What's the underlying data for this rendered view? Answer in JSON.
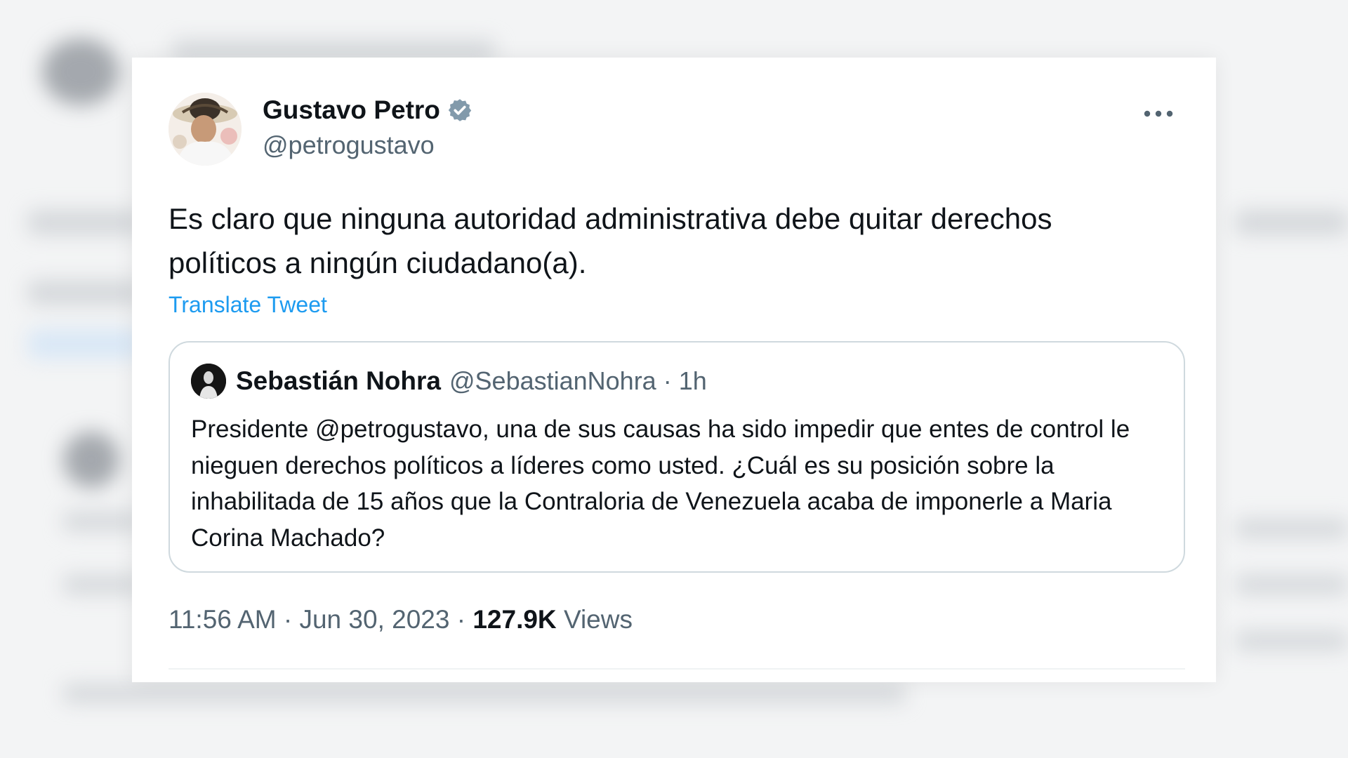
{
  "author": {
    "name": "Gustavo Petro",
    "handle": "@petrogustavo",
    "verified_icon": "verified-badge-icon"
  },
  "tweet": {
    "text": "Es claro que ninguna autoridad administrativa debe quitar derechos políticos a ningún ciudadano(a).",
    "translate_label": "Translate Tweet"
  },
  "quote": {
    "name": "Sebastián Nohra",
    "handle": "@SebastianNohra",
    "separator": "·",
    "time": "1h",
    "text": "Presidente @petrogustavo, una de sus causas ha sido impedir que entes de control le nieguen derechos políticos a líderes como usted. ¿Cuál es su posición sobre la inhabilitada de 15 años que la Contraloria de Venezuela acaba de imponerle a Maria Corina Machado?"
  },
  "meta": {
    "time": "11:56 AM",
    "separator": "·",
    "date": "Jun 30, 2023",
    "views_count": "127.9K",
    "views_label": "Views"
  },
  "more_icon": "more-horizontal-icon",
  "colors": {
    "text": "#0f1419",
    "secondary": "#536471",
    "link": "#1d9bf0",
    "verified": "#829aab",
    "border": "#cfd9de"
  }
}
